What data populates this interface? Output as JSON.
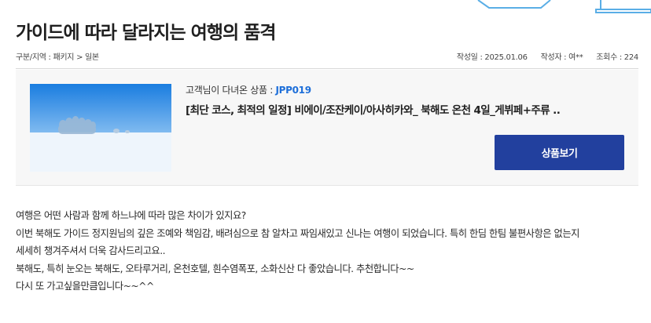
{
  "page": {
    "title": "가이드에 따라 달라지는 여행의 품격"
  },
  "meta": {
    "breadcrumb": "구분/지역 : 패키지 > 일본",
    "date": "작성일 : 2025.01.06",
    "author": "작성자 : 여**",
    "views": "조회수 : 224"
  },
  "product": {
    "review_prefix": "고객님이 다녀온 상품 : ",
    "code": "JPP019",
    "name": "[최단 코스, 최적의 일정] 비에이/조잔케이/아사히카와_ 북해도 온천 4일_게뷔페+주류 ..",
    "button_label": "상품보기",
    "thumbnail_icon": "snowfield-image"
  },
  "content": {
    "lines": [
      "여행은 어떤 사람과 함께 하느냐에 따라 많은 차이가 있지요?",
      "이번 북해도 가이드 정지원님의 깊은 조예와 책임감, 배려심으로 참 알차고 짜임새있고 신나는 여행이 되었습니다. 특히 한딤 한팀 불편사항은 없는지",
      "세세히 챙겨주셔서 더욱 감사드리고요..",
      "북해도, 특히 눈오는 북해도, 오타루거리, 온천호텔, 흰수염폭포, 소화신산 다 좋았습니다. 추천합니다~~",
      "다시 또 가고싶을만큼입니다~~^^"
    ]
  },
  "colors": {
    "button": "#22409e",
    "code_text": "#1e6fd9",
    "box_bg": "#f7f7f7"
  }
}
